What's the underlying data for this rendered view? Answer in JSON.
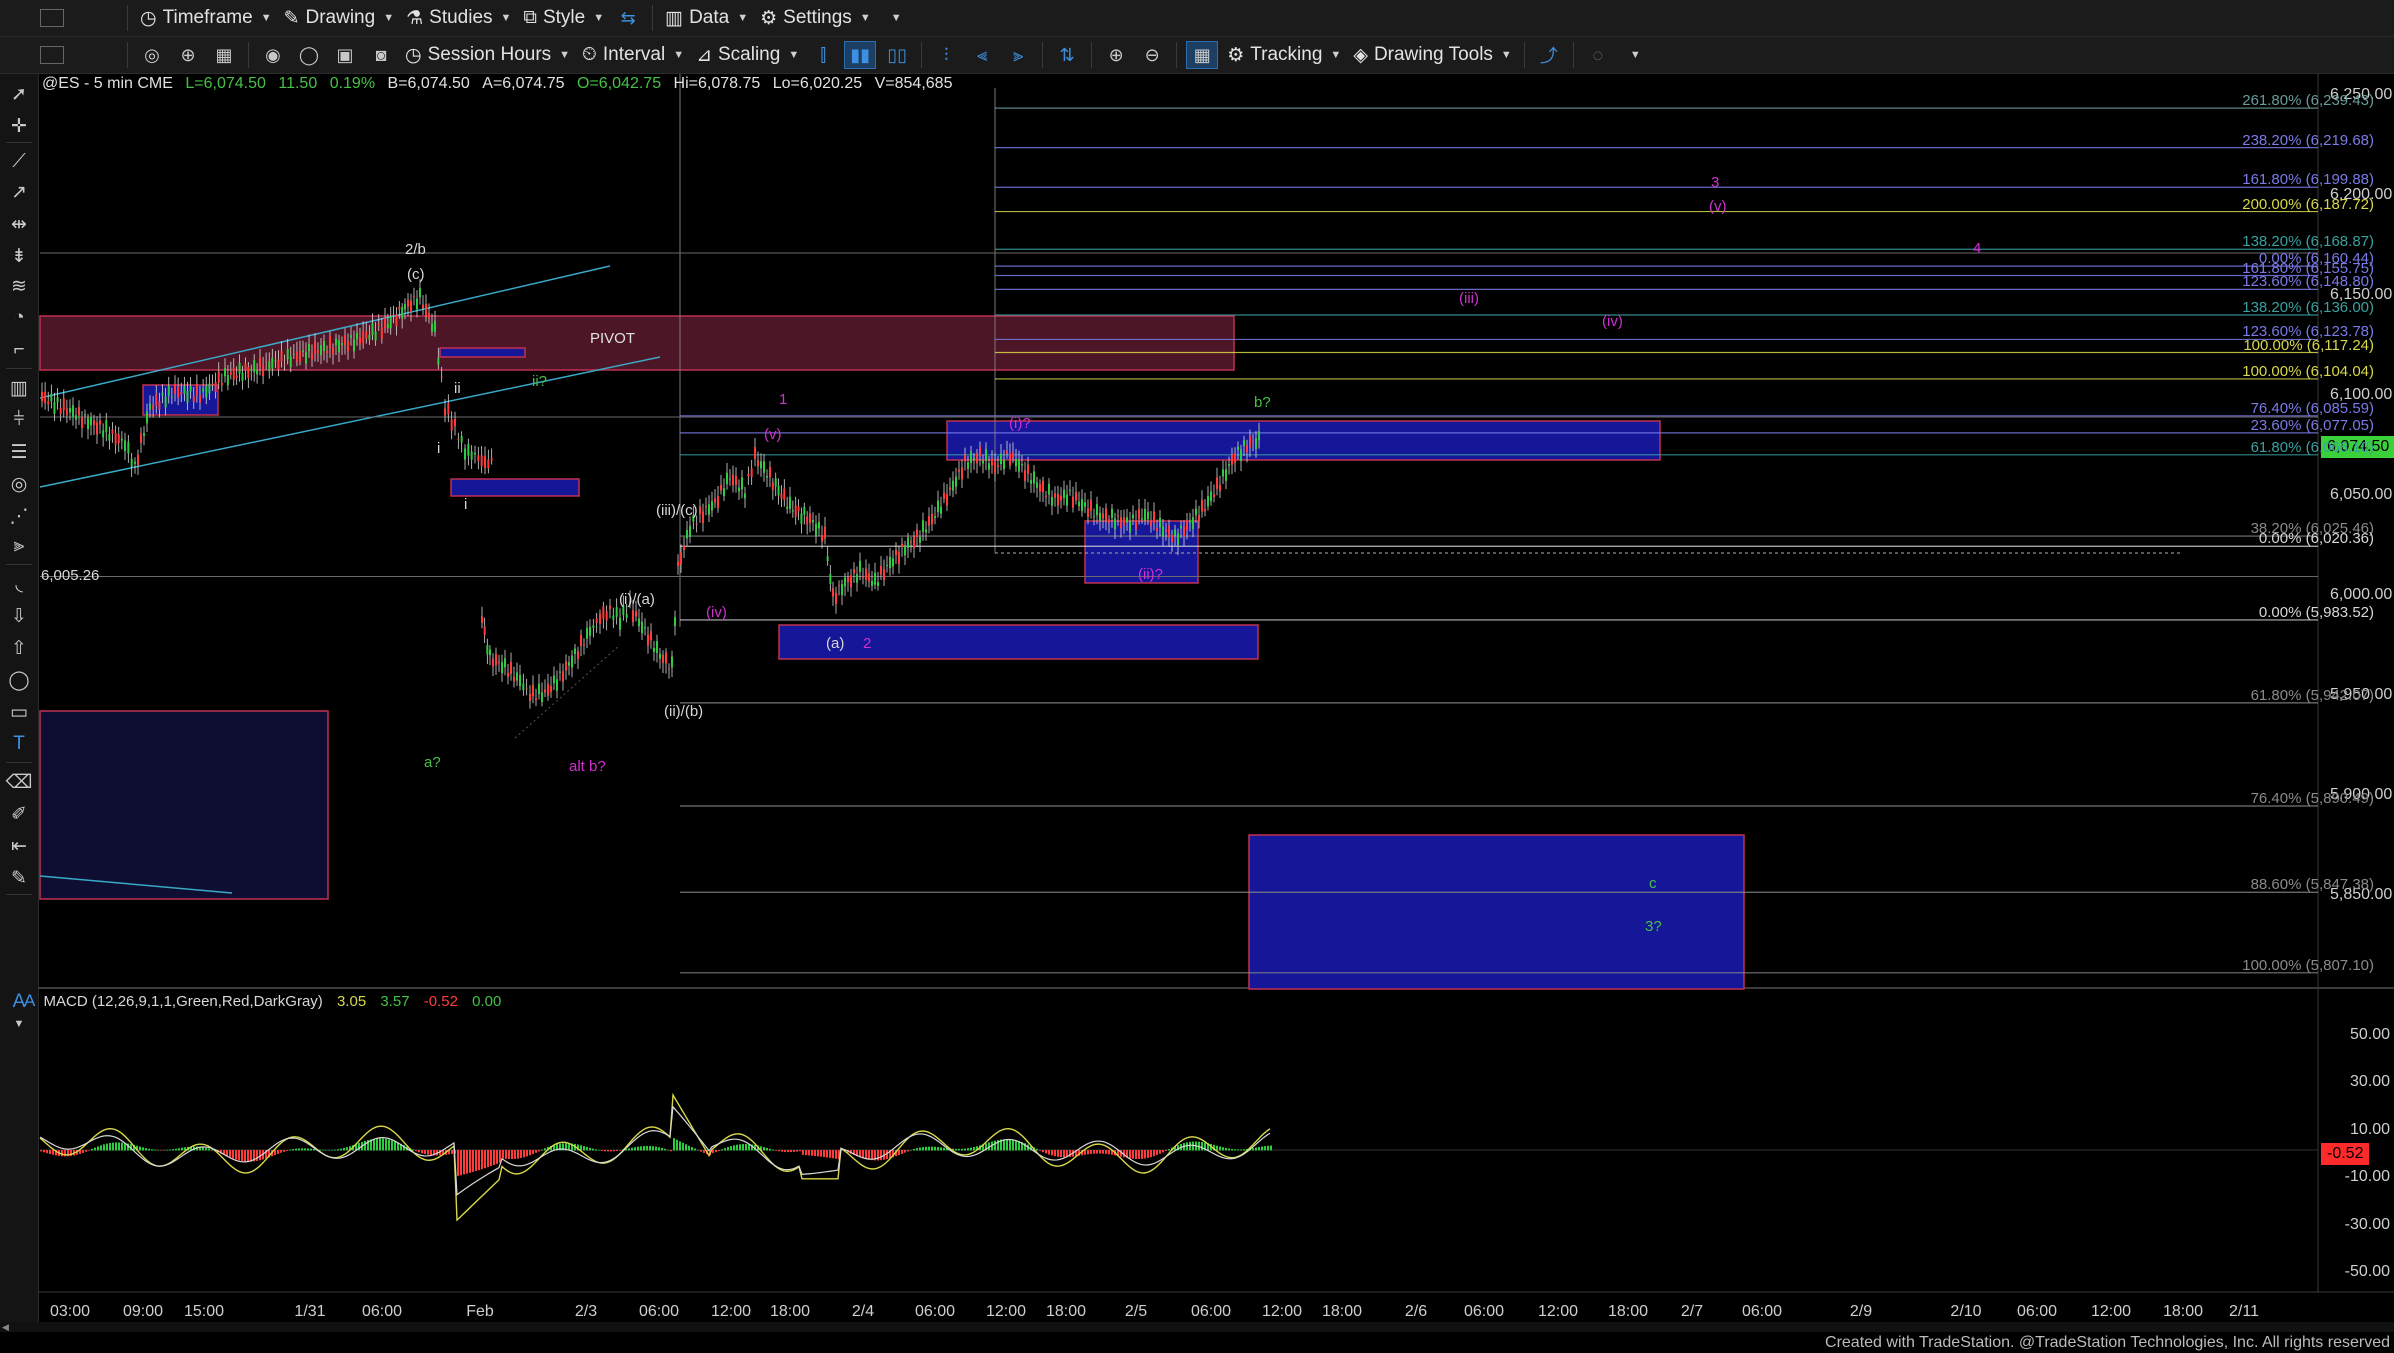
{
  "toolbar1": {
    "timeframe": "Timeframe",
    "drawing": "Drawing",
    "studies": "Studies",
    "style": "Style",
    "data": "Data",
    "settings": "Settings"
  },
  "toolbar2": {
    "session_hours": "Session Hours",
    "interval": "Interval",
    "scaling": "Scaling",
    "tracking": "Tracking",
    "drawing_tools": "Drawing Tools"
  },
  "symbol_info": {
    "symbol": "@ES - 5 min  CME",
    "last": "L=6,074.50",
    "change": "11.50",
    "pct": "0.19%",
    "bid": "B=6,074.50",
    "ask": "A=6,074.75",
    "open": "O=6,042.75",
    "high": "Hi=6,078.75",
    "low": "Lo=6,020.25",
    "volume": "V=854,685"
  },
  "colors": {
    "up_bar": "#2ecc40",
    "down_bar": "#ff3b3b",
    "fib_blue": "#3f5bd6",
    "fib_yellow": "#c9c94a",
    "wave_magenta": "#d030d0",
    "wave_green": "#46c046",
    "wave_white": "#d8d8d8",
    "price_tag": "#3ad13a"
  },
  "price_axis": [
    "6,250.00",
    "6,200.00",
    "6,150.00",
    "6,100.00",
    "6,050.00",
    "6,000.00",
    "5,950.00",
    "5,900.00",
    "5,850.00"
  ],
  "current_price": "6,074.50",
  "level_label": "6,005.26",
  "pivot_label": "PIVOT",
  "fib_labels": [
    {
      "text": "261.80% (6,239.43)",
      "price": 6239.43,
      "color": "#6a9a9a"
    },
    {
      "text": "238.20% (6,219.68)",
      "price": 6219.68,
      "color": "#7a7ae8"
    },
    {
      "text": "161.80% (6,199.88)",
      "price": 6199.88,
      "color": "#7a7ae8"
    },
    {
      "text": "200.00% (6,187.72)",
      "price": 6187.72,
      "color": "#d8d84a"
    },
    {
      "text": "138.20% (6,168.87)",
      "price": 6168.87,
      "color": "#3aa0a0"
    },
    {
      "text": "0.00% (6,160.44)",
      "price": 6160.44,
      "color": "#7a7ae8"
    },
    {
      "text": "161.80% (6,155.75)",
      "price": 6155.75,
      "color": "#7a7ae8"
    },
    {
      "text": "123.60% (6,148.80)",
      "price": 6148.8,
      "color": "#7a7ae8"
    },
    {
      "text": "138.20% (6,136.00)",
      "price": 6136.0,
      "color": "#3aa0a0"
    },
    {
      "text": "123.60% (6,123.78)",
      "price": 6123.78,
      "color": "#7a7ae8"
    },
    {
      "text": "100.00% (6,117.24)",
      "price": 6117.24,
      "color": "#d8d84a"
    },
    {
      "text": "100.00% (6,104.04)",
      "price": 6104.04,
      "color": "#d8d84a"
    },
    {
      "text": "76.40% (6,085.59)",
      "price": 6085.59,
      "color": "#7a7ae8"
    },
    {
      "text": "23.60% (6,077.05)",
      "price": 6077.05,
      "color": "#7a7ae8"
    },
    {
      "text": "61.80% (6,066.10)",
      "price": 6066.1,
      "color": "#3aa0a0"
    },
    {
      "text": "38.20% (6,025.46)",
      "price": 6025.46,
      "color": "#8a8a8a"
    },
    {
      "text": "0.00% (6,020.36)",
      "price": 6020.36,
      "color": "#d8d8d8"
    },
    {
      "text": "0.00% (5,983.52)",
      "price": 5983.52,
      "color": "#d8d8d8"
    },
    {
      "text": "61.80% (5,942.07)",
      "price": 5942.07,
      "color": "#8a8a8a"
    },
    {
      "text": "76.40% (5,890.49)",
      "price": 5890.49,
      "color": "#8a8a8a"
    },
    {
      "text": "88.60% (5,847.38)",
      "price": 5847.38,
      "color": "#8a8a8a"
    },
    {
      "text": "100.00% (5,807.10)",
      "price": 5807.1,
      "color": "#8a8a8a"
    }
  ],
  "wave_labels": [
    {
      "text": "2/b",
      "color": "#d8d8d8"
    },
    {
      "text": "(c)",
      "color": "#d8d8d8"
    },
    {
      "text": "ii",
      "color": "#d8d8d8"
    },
    {
      "text": "i",
      "color": "#d8d8d8"
    },
    {
      "text": "i",
      "color": "#d8d8d8"
    },
    {
      "text": "ii?",
      "color": "#46c046"
    },
    {
      "text": "a?",
      "color": "#46c046"
    },
    {
      "text": "alt b?",
      "color": "#d030d0"
    },
    {
      "text": "(iii)/(c)",
      "color": "#d8d8d8"
    },
    {
      "text": "(i)/(a)",
      "color": "#d8d8d8"
    },
    {
      "text": "(ii)/(b)",
      "color": "#d8d8d8"
    },
    {
      "text": "(iv)",
      "color": "#d030d0"
    },
    {
      "text": "1",
      "color": "#d030d0"
    },
    {
      "text": "(v)",
      "color": "#d030d0"
    },
    {
      "text": "(a)",
      "color": "#d8d8d8"
    },
    {
      "text": "2",
      "color": "#d030d0"
    },
    {
      "text": "(i)?",
      "color": "#d030d0"
    },
    {
      "text": "(ii)?",
      "color": "#d030d0"
    },
    {
      "text": "b?",
      "color": "#46c046"
    },
    {
      "text": "(iii)",
      "color": "#d030d0"
    },
    {
      "text": "(iv)",
      "color": "#d030d0"
    },
    {
      "text": "3",
      "color": "#d030d0"
    },
    {
      "text": "(v)",
      "color": "#d030d0"
    },
    {
      "text": "4",
      "color": "#d030d0"
    },
    {
      "text": "c",
      "color": "#46c046"
    },
    {
      "text": "3?",
      "color": "#46c046"
    }
  ],
  "macd": {
    "title": "MACD (12,26,9,1,1,Green,Red,DarkGray)",
    "v1": "3.05",
    "v2": "3.57",
    "v3": "-0.52",
    "v4": "0.00",
    "axis": [
      "50.00",
      "30.00",
      "10.00",
      "-10.00",
      "-30.00",
      "-50.00"
    ],
    "tag": "-0.52"
  },
  "time_axis": [
    "03:00",
    "09:00",
    "15:00",
    "1/31",
    "06:00",
    "Feb",
    "2/3",
    "06:00",
    "12:00",
    "18:00",
    "2/4",
    "06:00",
    "12:00",
    "18:00",
    "2/5",
    "06:00",
    "12:00",
    "18:00",
    "2/6",
    "06:00",
    "12:00",
    "18:00",
    "2/7",
    "06:00",
    "2/9",
    "2/10",
    "06:00",
    "12:00",
    "18:00",
    "2/11"
  ],
  "footer": "Created with TradeStation. @TradeStation Technologies, Inc. All rights reserved"
}
